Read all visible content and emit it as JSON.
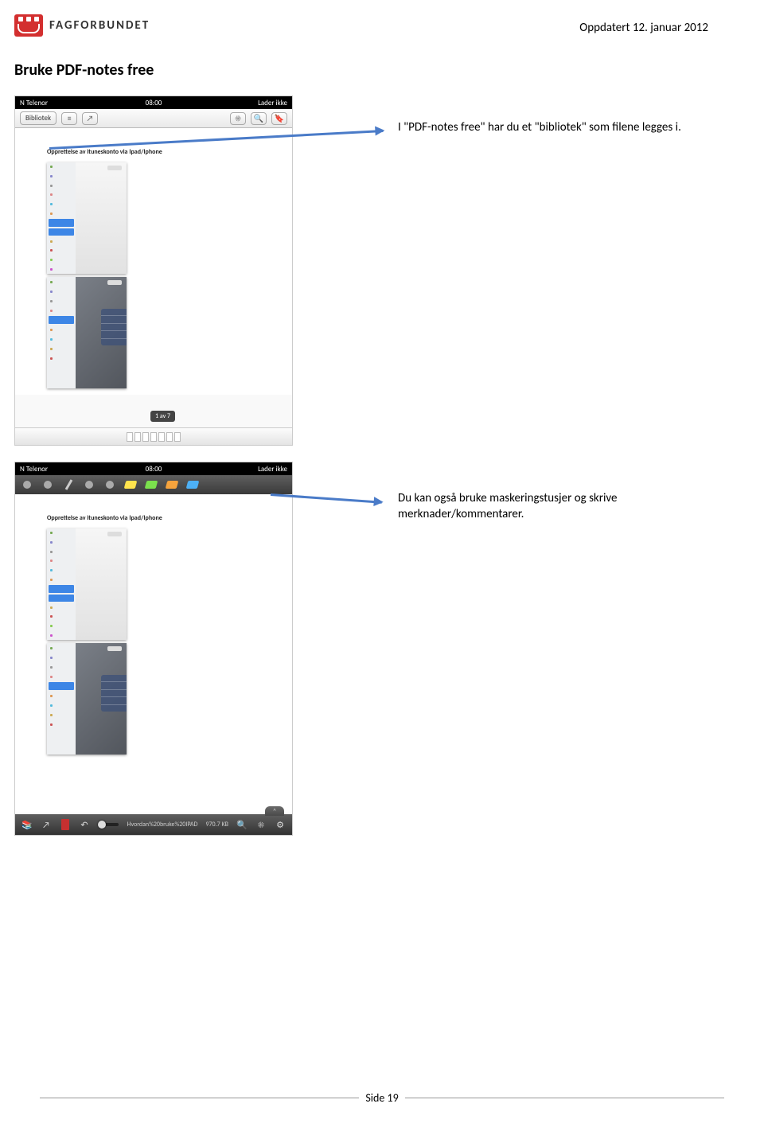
{
  "header": {
    "logo_text": "FAGFORBUNDET",
    "date": "Oppdatert 12. januar 2012"
  },
  "heading": "Bruke PDF-notes free",
  "note1": "I \"PDF-notes free\" har du et \"bibliotek\" som filene legges i.",
  "note2": "Du kan også bruke maskeringstusjer og skrive merknader/kommentarer.",
  "statusbar": {
    "carrier": "N Telenor",
    "time": "08:00",
    "status": "Lader ikke"
  },
  "toolbar": {
    "library": "Bibliotek",
    "list_icon": "≡",
    "share_icon": "↗",
    "brightness_icon": "☀",
    "search_icon": "🔍",
    "bookmark_icon": "🔖"
  },
  "doc_subtitle": "Opprettelse av ituneskonto via Ipad/Iphone",
  "page_badge": "1 av 7",
  "bottom2": {
    "books_icon": "📚",
    "share_icon": "↗",
    "search_icon": "🔍",
    "sun_icon": "☀",
    "gear_icon": "⚙",
    "up_icon": "˄",
    "filename": "Hvordan%20bruke%20IPAD",
    "filesize": "970.7 KB"
  },
  "footer": {
    "page": "Side 19"
  }
}
